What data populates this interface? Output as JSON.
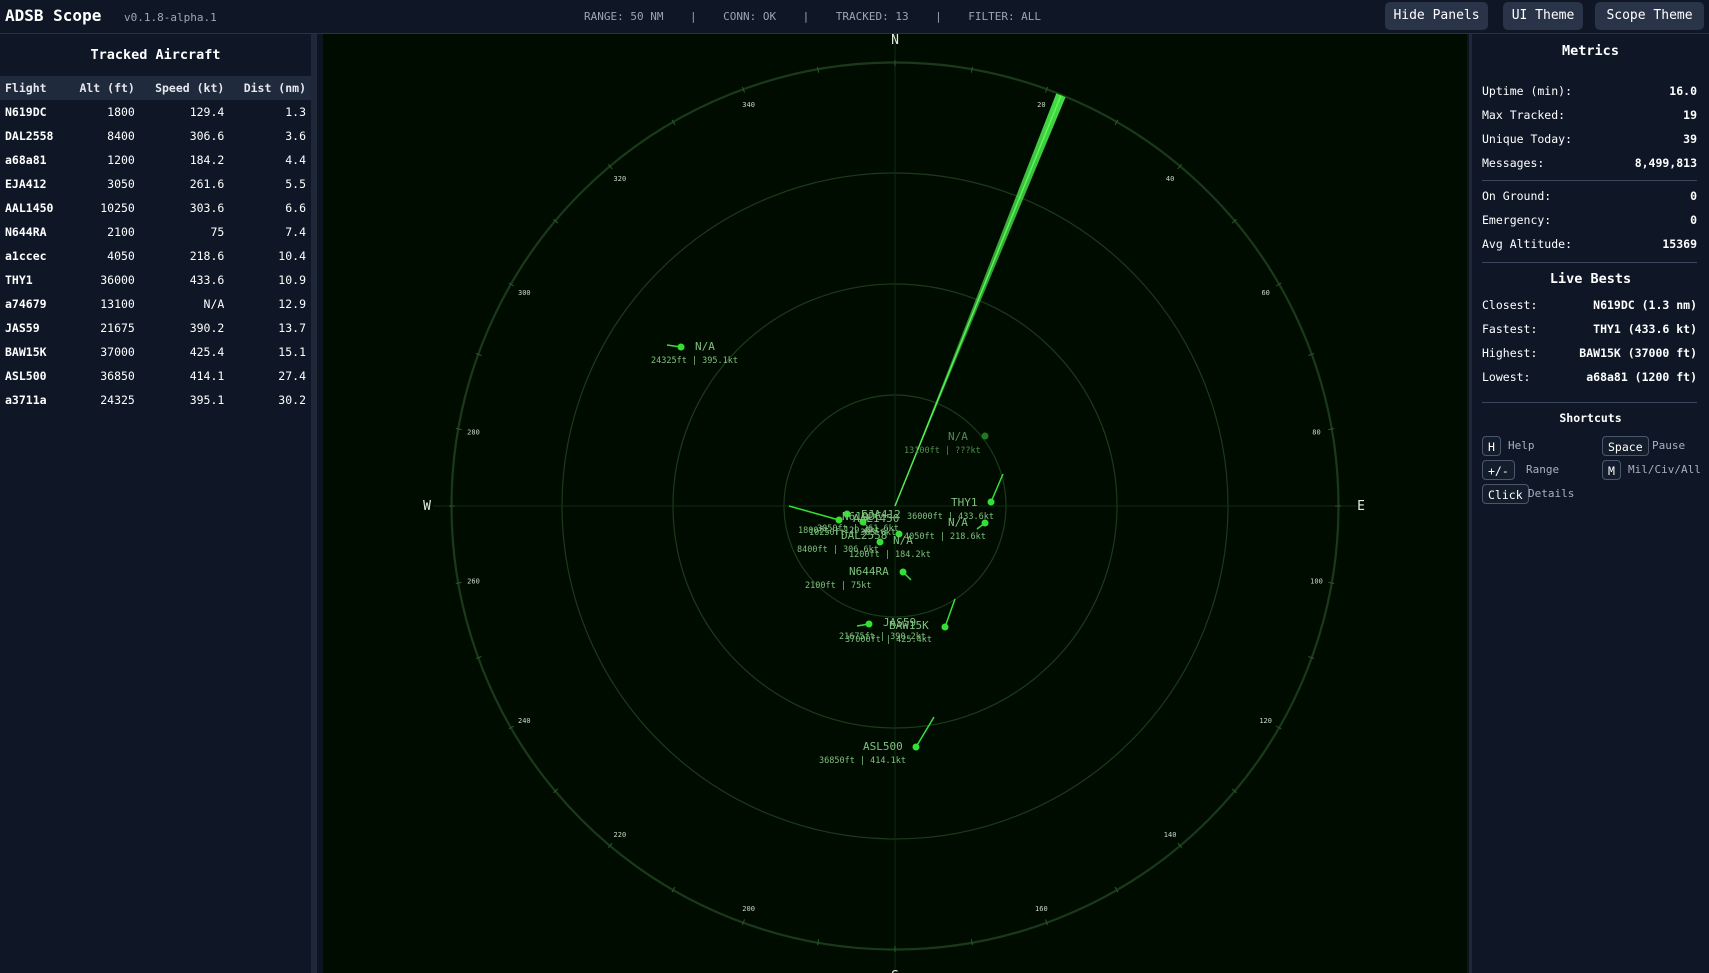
{
  "app": {
    "title": "ADSB Scope",
    "version": "v0.1.8-alpha.1"
  },
  "status": {
    "range": "RANGE: 50 NM",
    "sep": "|",
    "conn": "CONN: OK",
    "tracked": "TRACKED: 13",
    "filter": "FILTER: ALL"
  },
  "buttons": {
    "hide_panels": "Hide Panels",
    "ui_theme": "UI Theme",
    "scope_theme": "Scope Theme"
  },
  "left_panel": {
    "title": "Tracked Aircraft",
    "columns": [
      "Flight",
      "Alt (ft)",
      "Speed (kt)",
      "Dist (nm)"
    ],
    "rows": [
      [
        "N619DC",
        "1800",
        "129.4",
        "1.3"
      ],
      [
        "DAL2558",
        "8400",
        "306.6",
        "3.6"
      ],
      [
        "a68a81",
        "1200",
        "184.2",
        "4.4"
      ],
      [
        "EJA412",
        "3050",
        "261.6",
        "5.5"
      ],
      [
        "AAL1450",
        "10250",
        "303.6",
        "6.6"
      ],
      [
        "N644RA",
        "2100",
        "75",
        "7.4"
      ],
      [
        "a1ccec",
        "4050",
        "218.6",
        "10.4"
      ],
      [
        "THY1",
        "36000",
        "433.6",
        "10.9"
      ],
      [
        "a74679",
        "13100",
        "N/A",
        "12.9"
      ],
      [
        "JAS59",
        "21675",
        "390.2",
        "13.7"
      ],
      [
        "BAW15K",
        "37000",
        "425.4",
        "15.1"
      ],
      [
        "ASL500",
        "36850",
        "414.1",
        "27.4"
      ],
      [
        "a3711a",
        "24325",
        "395.1",
        "30.2"
      ]
    ]
  },
  "scope": {
    "cardinals": {
      "n": "N",
      "s": "S",
      "e": "E",
      "w": "W"
    },
    "bearing_labels": [
      "20",
      "40",
      "60",
      "80",
      "100",
      "120",
      "140",
      "160",
      "200",
      "220",
      "240",
      "260",
      "280",
      "300",
      "320",
      "340"
    ],
    "sweep_bearing_deg": 22,
    "colors": {
      "primary": "#35e035",
      "dim": "#1f7a1f",
      "ring": "#1b3a1b"
    },
    "targets": [
      {
        "id": "a3711a",
        "label": "N/A",
        "info": "24325ft | 395.1kt"
      },
      {
        "id": "a74679",
        "label": "N/A",
        "info": "13100ft | ???kt"
      },
      {
        "id": "THY1",
        "label": "THY1",
        "info": "36000ft | 433.6kt"
      },
      {
        "id": "a1ccec",
        "label": "N/A",
        "info": "4050ft | 218.6kt"
      },
      {
        "id": "EJA412",
        "label": "EJA412",
        "info": "3050ft | 261.6kt"
      },
      {
        "id": "AAL1450",
        "label": "AAL1450",
        "info": "10250ft | 303.6kt"
      },
      {
        "id": "N619DC",
        "label": "N619DC",
        "info": "1800ft | 129.4kt"
      },
      {
        "id": "DAL2558",
        "label": "DAL2558",
        "info": "8400ft | 306.6kt"
      },
      {
        "id": "a68a81",
        "label": "N/A",
        "info": "1200ft | 184.2kt"
      },
      {
        "id": "N644RA",
        "label": "N644RA",
        "info": "2100ft | 75kt"
      },
      {
        "id": "JAS59",
        "label": "JAS59",
        "info": "21675ft | 390.2kt"
      },
      {
        "id": "BAW15K",
        "label": "BAW15K",
        "info": "37000ft | 425.4kt"
      },
      {
        "id": "ASL500",
        "label": "ASL500",
        "info": "36850ft | 414.1kt"
      }
    ]
  },
  "metrics": {
    "title": "Metrics",
    "uptime": {
      "label": "Uptime (min):",
      "value": "16.0"
    },
    "max_tracked": {
      "label": "Max Tracked:",
      "value": "19"
    },
    "unique_today": {
      "label": "Unique Today:",
      "value": "39"
    },
    "messages": {
      "label": "Messages:",
      "value": "8,499,813"
    },
    "on_ground": {
      "label": "On Ground:",
      "value": "0"
    },
    "emergency": {
      "label": "Emergency:",
      "value": "0"
    },
    "avg_altitude": {
      "label": "Avg Altitude:",
      "value": "15369"
    }
  },
  "live_bests": {
    "title": "Live Bests",
    "closest": {
      "label": "Closest:",
      "value": "N619DC (1.3 nm)"
    },
    "fastest": {
      "label": "Fastest:",
      "value": "THY1 (433.6 kt)"
    },
    "highest": {
      "label": "Highest:",
      "value": "BAW15K (37000 ft)"
    },
    "lowest": {
      "label": "Lowest:",
      "value": "a68a81 (1200 ft)"
    }
  },
  "shortcuts": {
    "title": "Shortcuts",
    "help": {
      "key": "H",
      "desc": "Help"
    },
    "pause": {
      "key": "Space",
      "desc": "Pause"
    },
    "range": {
      "key": "+/-",
      "desc": "Range"
    },
    "mil": {
      "key": "M",
      "desc": "Mil/Civ/All"
    },
    "details": {
      "key": "Click",
      "desc": "Details"
    }
  }
}
